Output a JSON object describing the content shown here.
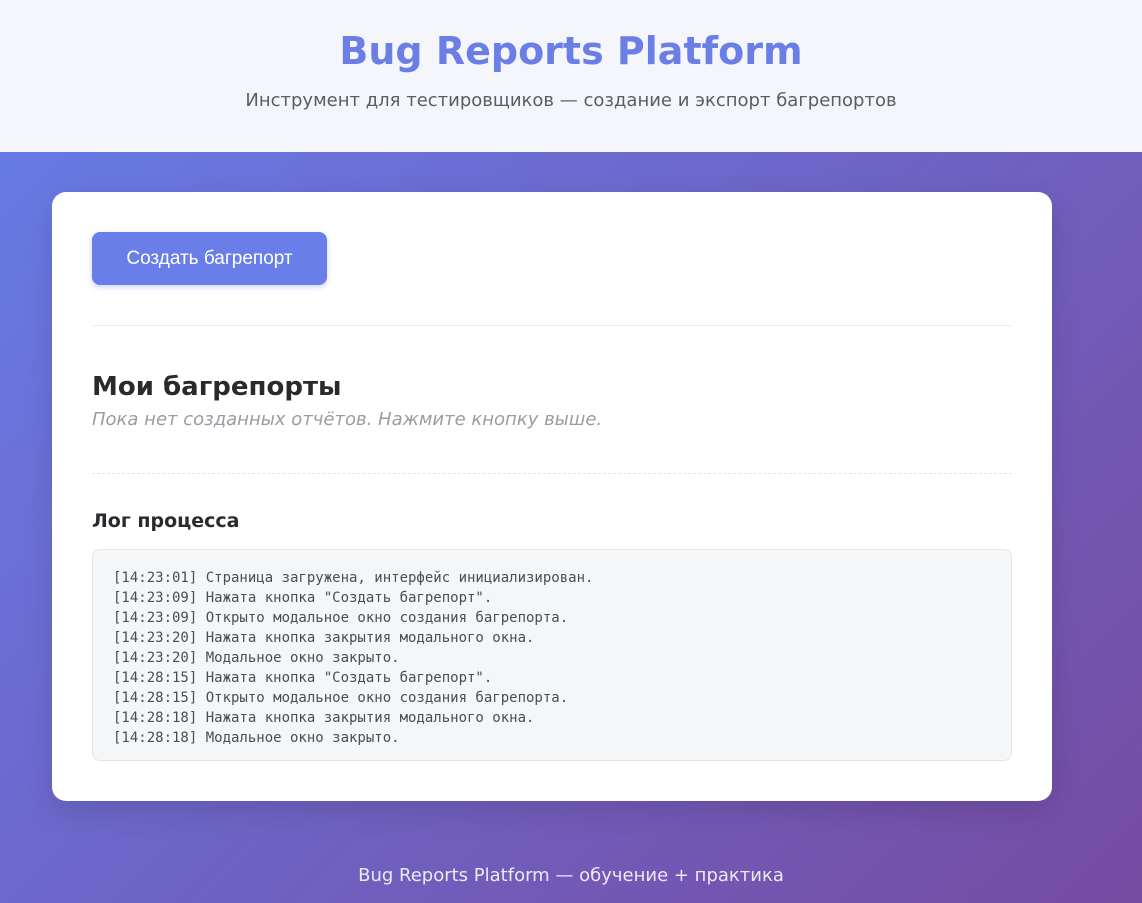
{
  "header": {
    "title": "Bug Reports Platform",
    "subtitle": "Инструмент для тестировщиков — создание и экспорт багрепортов"
  },
  "actions": {
    "create_label": "Создать багрепорт"
  },
  "reports": {
    "title": "Мои багрепорты",
    "empty_text": "Пока нет созданных отчётов. Нажмите кнопку выше."
  },
  "log": {
    "title": "Лог процесса",
    "lines": [
      "[14:23:01] Страница загружена, интерфейс инициализирован.",
      "[14:23:09] Нажата кнопка \"Создать багрепорт\".",
      "[14:23:09] Открыто модальное окно создания багрепорта.",
      "[14:23:20] Нажата кнопка закрытия модального окна.",
      "[14:23:20] Модальное окно закрыто.",
      "[14:28:15] Нажата кнопка \"Создать багрепорт\".",
      "[14:28:15] Открыто модальное окно создания багрепорта.",
      "[14:28:18] Нажата кнопка закрытия модального окна.",
      "[14:28:18] Модальное окно закрыто."
    ]
  },
  "footer": {
    "text": "Bug Reports Platform — обучение + практика"
  },
  "colors": {
    "accent": "#6a7ee9",
    "gradient_start": "#667eea",
    "gradient_end": "#764ba2"
  }
}
